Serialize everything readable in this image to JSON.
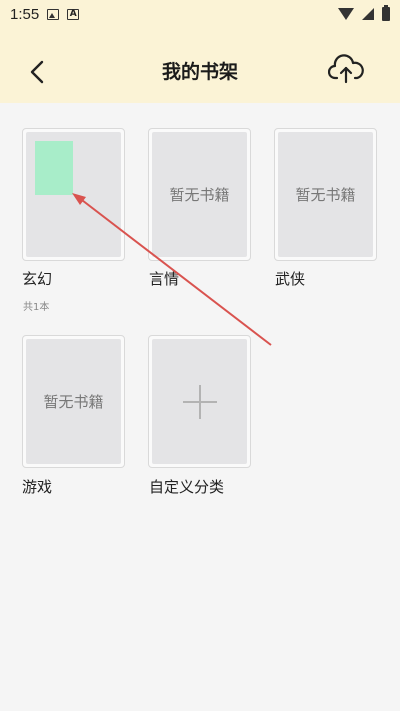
{
  "status_bar": {
    "time": "1:55"
  },
  "header": {
    "title": "我的书架"
  },
  "categories": [
    {
      "label": "玄幻",
      "count": "共1本",
      "placeholder": ""
    },
    {
      "label": "言情",
      "placeholder": "暂无书籍"
    },
    {
      "label": "武侠",
      "placeholder": "暂无书籍"
    },
    {
      "label": "游戏",
      "placeholder": "暂无书籍"
    }
  ],
  "custom_category": {
    "label": "自定义分类"
  },
  "colors": {
    "header_bg": "#fbf3d6",
    "page_bg": "#f5f5f5",
    "cover_thumb": "#a8edc9",
    "annotation_arrow": "#d9534f"
  }
}
